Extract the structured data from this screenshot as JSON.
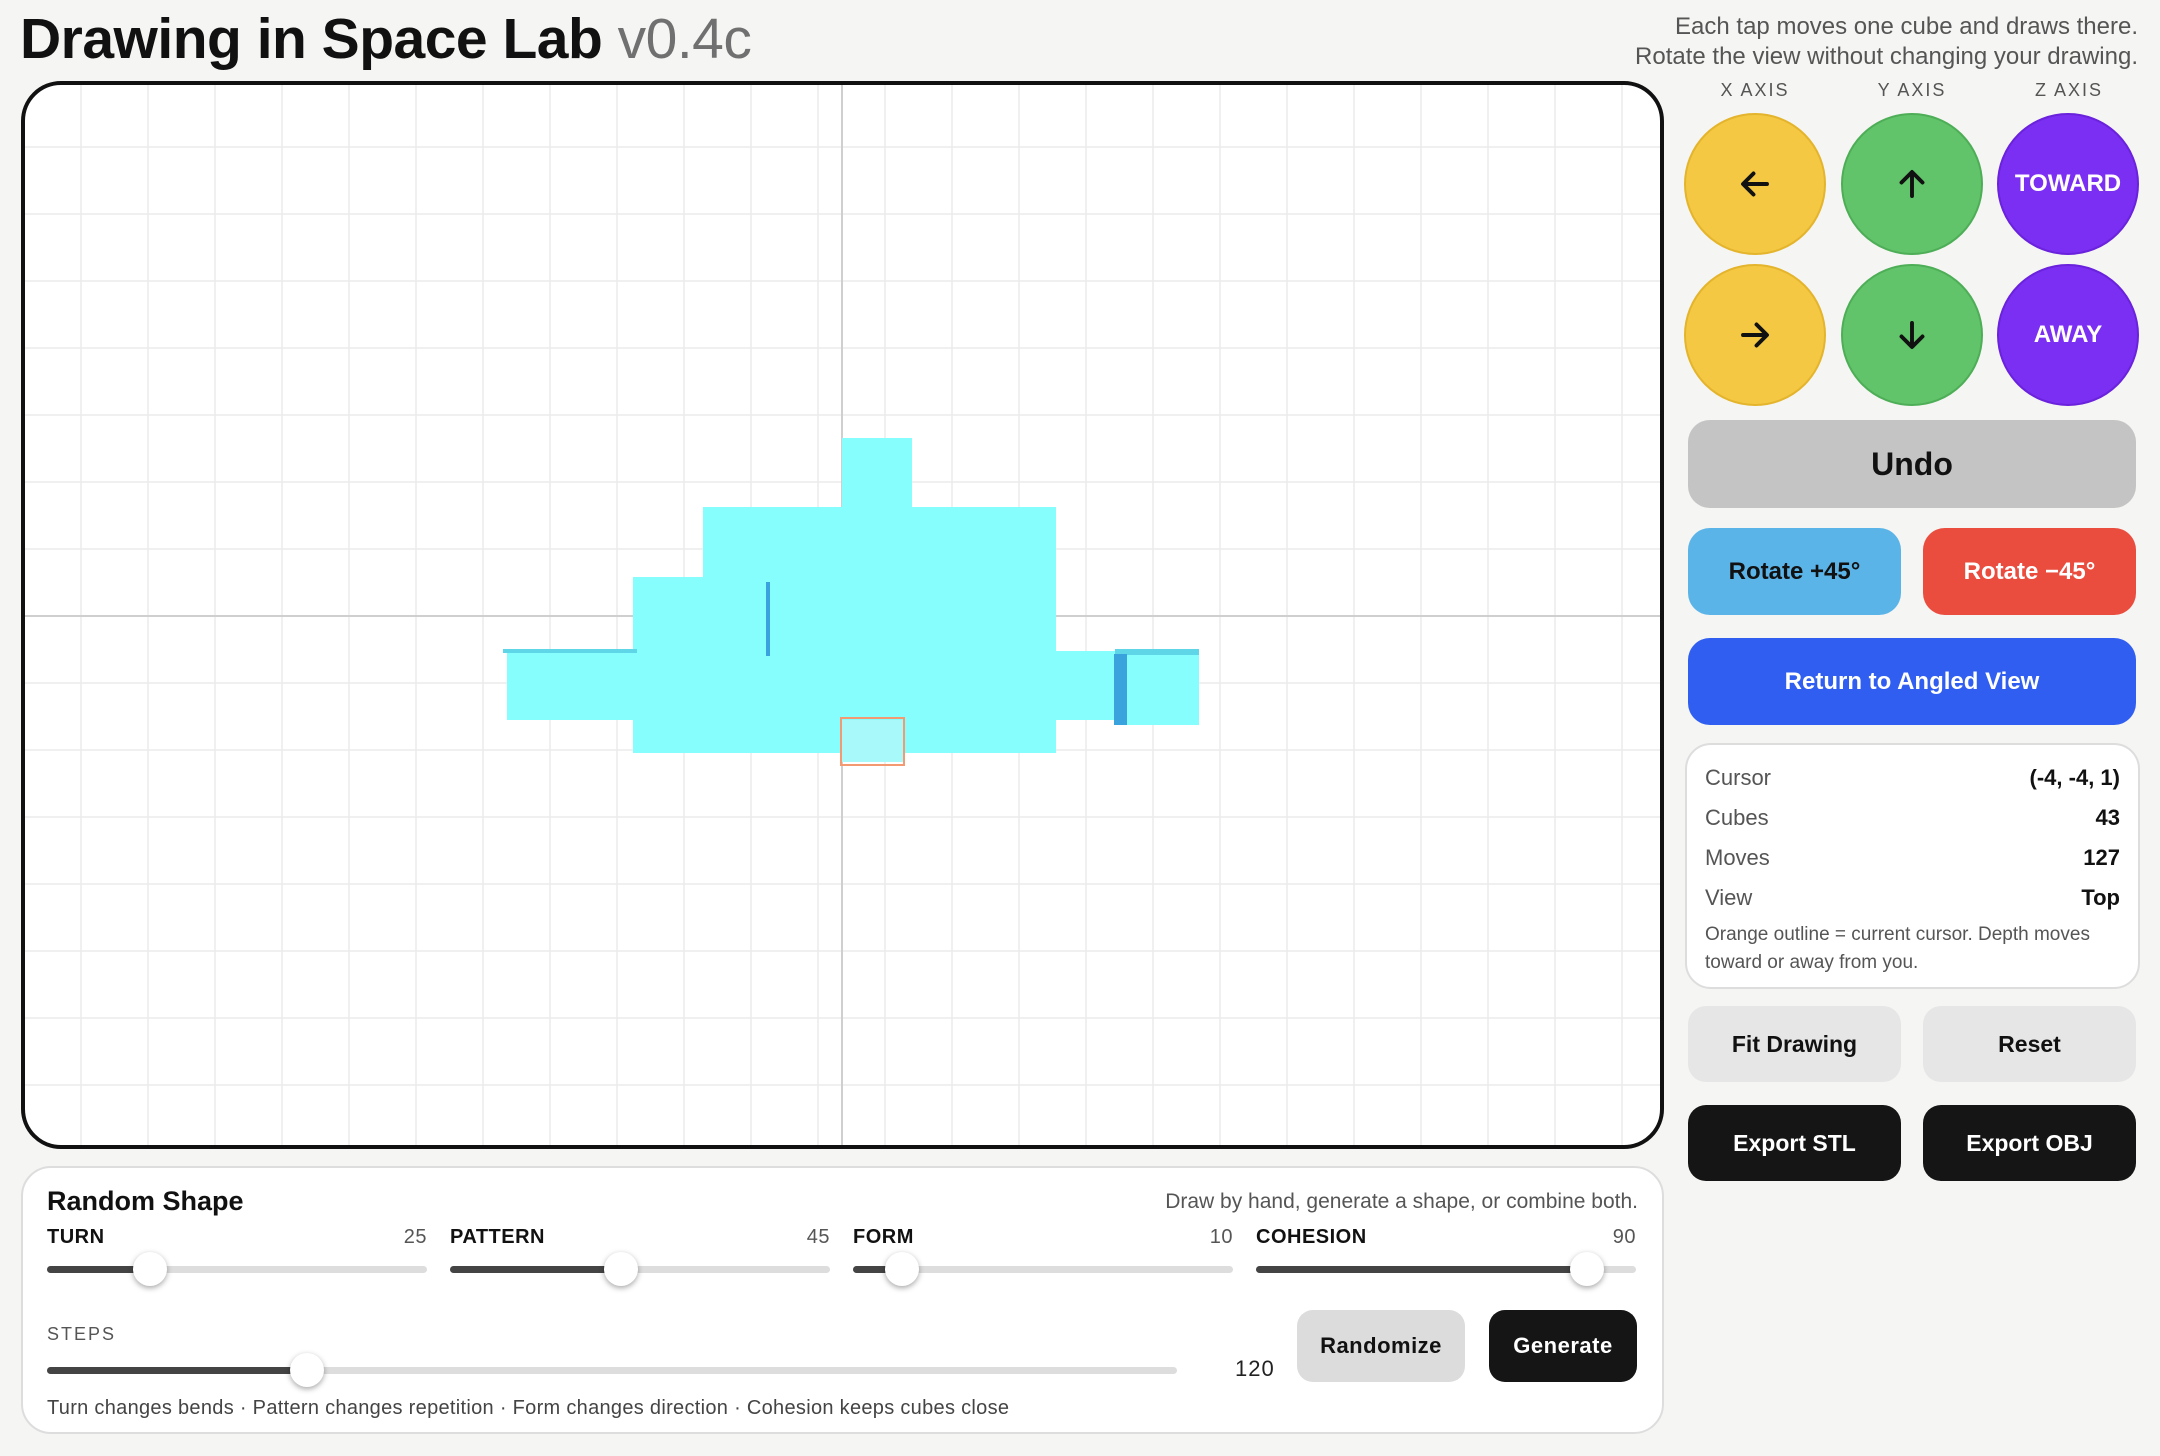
{
  "app": {
    "title": "Drawing in Space Lab",
    "version": "v0.4c"
  },
  "hint": {
    "line1": "Each tap moves one cube and draws there.",
    "line2": "Rotate the view without changing your drawing."
  },
  "axes": {
    "x_label": "X AXIS",
    "y_label": "Y AXIS",
    "z_label": "Z AXIS"
  },
  "move_buttons": {
    "x_neg_icon": "arrow-left-icon",
    "x_pos_icon": "arrow-right-icon",
    "y_pos_icon": "arrow-up-icon",
    "y_neg_icon": "arrow-down-icon",
    "z_toward": "TOWARD",
    "z_away": "AWAY"
  },
  "controls": {
    "undo": "Undo",
    "rotate_plus": "Rotate +45°",
    "rotate_minus": "Rotate −45°",
    "return_view": "Return to Angled View",
    "fit": "Fit Drawing",
    "reset": "Reset",
    "export_stl": "Export STL",
    "export_obj": "Export OBJ"
  },
  "status": {
    "cursor_label": "Cursor",
    "cursor_value": "(-4, -4, 1)",
    "cubes_label": "Cubes",
    "cubes_value": "43",
    "moves_label": "Moves",
    "moves_value": "127",
    "view_label": "View",
    "view_value": "Top",
    "note": "Orange outline = current cursor. Depth moves toward or away from you."
  },
  "random_shape": {
    "title": "Random Shape",
    "description": "Draw by hand, generate a shape, or combine both.",
    "sliders": [
      {
        "name": "TURN",
        "value": "25",
        "fraction": 0.27
      },
      {
        "name": "PATTERN",
        "value": "45",
        "fraction": 0.45
      },
      {
        "name": "FORM",
        "value": "10",
        "fraction": 0.13
      },
      {
        "name": "COHESION",
        "value": "90",
        "fraction": 0.87
      }
    ],
    "steps_label": "STEPS",
    "steps_value": "120",
    "steps_fraction": 0.23,
    "randomize": "Randomize",
    "generate": "Generate",
    "footer": "Turn changes bends · Pattern changes repetition · Form changes direction · Cohesion keeps cubes close"
  },
  "colors": {
    "cube": "#86fefe",
    "cube_shade": "#3aa2dd",
    "cursor_outline": "#f39a72",
    "yellow": "#f4c843",
    "green": "#61c46a",
    "purple": "#7b2ff2",
    "rotate_plus": "#5bb4e8",
    "rotate_minus": "#ea4c3e",
    "return_view": "#2f5ef0",
    "undo": "#c4c4c4"
  }
}
